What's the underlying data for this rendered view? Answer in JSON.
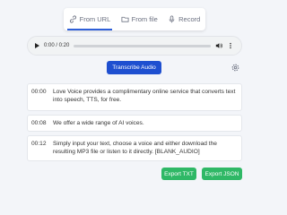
{
  "tabs": [
    {
      "label": "From URL",
      "icon": "link-icon",
      "active": true
    },
    {
      "label": "From file",
      "icon": "folder-icon",
      "active": false
    },
    {
      "label": "Record",
      "icon": "microphone-icon",
      "active": false
    }
  ],
  "player": {
    "time": "0:00 / 0:20",
    "progress": 0
  },
  "transcribe_label": "Transcribe Audio",
  "transcript": [
    {
      "time": "00:00",
      "text": "Love Voice provides a complimentary online service that converts text into speech, TTS, for free."
    },
    {
      "time": "00:08",
      "text": "We offer a wide range of AI voices."
    },
    {
      "time": "00:12",
      "text": "Simply input your text, choose a voice and either download the resulting MP3 file or listen to it directly. [BLANK_AUDIO]"
    }
  ],
  "export": {
    "txt_label": "Export TXT",
    "json_label": "Export JSON"
  },
  "colors": {
    "accent": "#1e4fd0",
    "export": "#2fb866"
  }
}
